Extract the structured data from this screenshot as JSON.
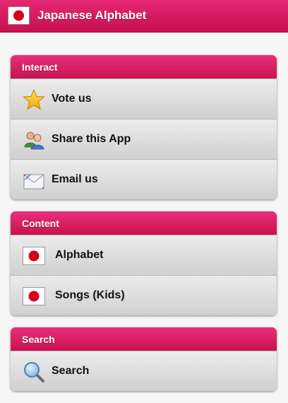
{
  "app": {
    "title": "Japanese Alphabet",
    "accent_color": "#d01a5a",
    "flag_icon": "japan-flag-icon"
  },
  "groups": [
    {
      "header": "Interact",
      "items": [
        {
          "label": "Vote us",
          "icon": "star-icon"
        },
        {
          "label": "Share this App",
          "icon": "people-icon"
        },
        {
          "label": "Email us",
          "icon": "envelope-icon"
        }
      ]
    },
    {
      "header": "Content",
      "items": [
        {
          "label": "Alphabet",
          "icon": "japan-flag-icon"
        },
        {
          "label": "Songs (Kids)",
          "icon": "japan-flag-icon"
        }
      ]
    },
    {
      "header": "Search",
      "items": [
        {
          "label": "Search",
          "icon": "magnifier-icon"
        }
      ]
    }
  ]
}
